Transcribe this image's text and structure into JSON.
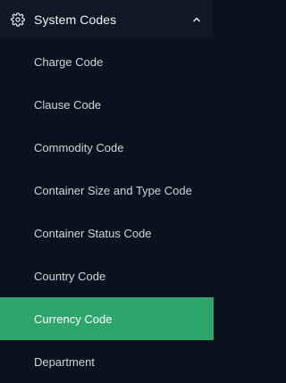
{
  "sidebar": {
    "group": {
      "title": "System Codes",
      "icon": "gear-icon",
      "chevron_icon": "chevron-up-icon",
      "items": [
        {
          "label": "Charge Code",
          "active": false
        },
        {
          "label": "Clause Code",
          "active": false
        },
        {
          "label": "Commodity Code",
          "active": false
        },
        {
          "label": "Container Size and Type Code",
          "active": false
        },
        {
          "label": "Container Status Code",
          "active": false
        },
        {
          "label": "Country Code",
          "active": false
        },
        {
          "label": "Currency Code",
          "active": true
        },
        {
          "label": "Department",
          "active": false
        }
      ]
    },
    "colors": {
      "background": "#0b121d",
      "header_background": "#0f1824",
      "active_background": "#2fa56e",
      "text": "#cfd5dc",
      "active_text": "#ffffff"
    }
  }
}
